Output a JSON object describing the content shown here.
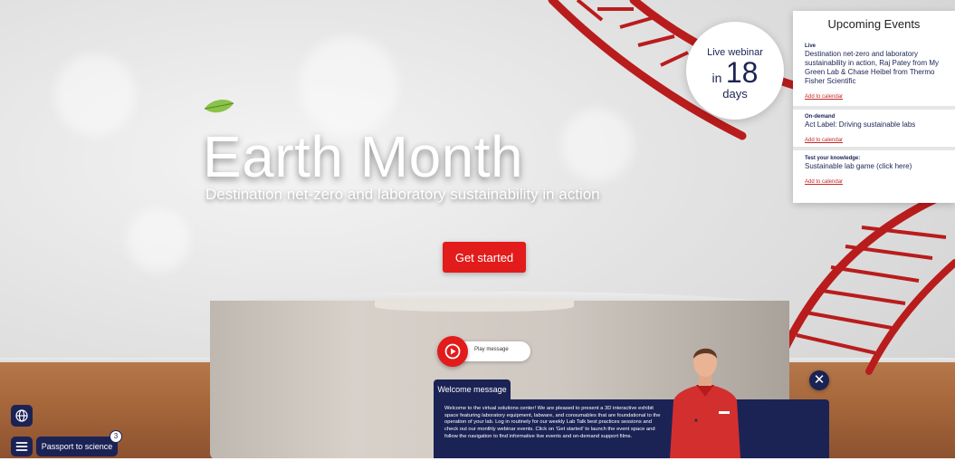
{
  "hero": {
    "title": "Earth Month",
    "subtitle": "Destination net-zero and laboratory sustainability in action",
    "cta_label": "Get started"
  },
  "countdown": {
    "label": "Live webinar",
    "prefix": "in",
    "number": "18",
    "unit": "days"
  },
  "events": {
    "title": "Upcoming Events",
    "items": [
      {
        "type": "Live",
        "description": "Destination net-zero and laboratory sustainability in action, Raj Patey from My Green Lab & Chase Heibel from Thermo Fisher Scientific",
        "calendar_link": "Add to calendar"
      },
      {
        "type": "On-demand",
        "description": "Act Label: Driving sustainable labs",
        "calendar_link": "Add to calendar"
      },
      {
        "type": "Test your knowledge:",
        "description": "Sustainable lab game (click here)",
        "calendar_link": "Add to calendar"
      }
    ]
  },
  "play": {
    "label": "Play message"
  },
  "welcome": {
    "tab_label": "Welcome message",
    "text": "Welcome to the virtual solutions center! We are pleased to present a 3D interactive exhibit space featuring laboratory equipment, labware, and consumables that are foundational to the operation of your lab. Log in routinely for our weekly Lab Talk best practices sessions and check out our monthly webinar events. Click on 'Get started' to launch the event space and follow the navigation to find informative live events and on-demand support films.",
    "close_symbol": "✕"
  },
  "footer": {
    "passport_label": "Passport to science",
    "passport_count": "3"
  },
  "icons": {
    "leaf": "leaf-icon",
    "play": "play-circle-icon",
    "close": "close-icon",
    "globe": "globe-icon",
    "menu": "hamburger-menu-icon"
  },
  "colors": {
    "accent_red": "#e21b1b",
    "navy": "#1b2355",
    "dna_red": "#b91c1c",
    "leaf_green": "#8bc34a"
  }
}
